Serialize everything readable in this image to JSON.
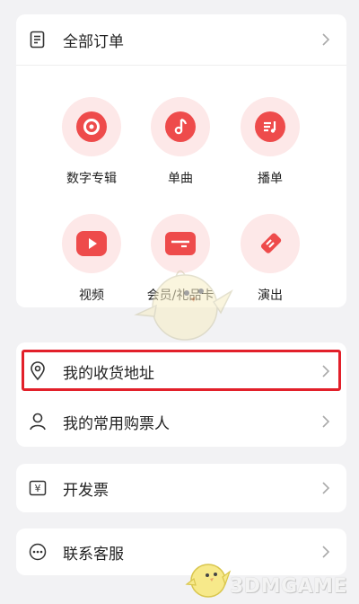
{
  "orders": {
    "all_orders_label": "全部订单",
    "icon": "order-list-icon",
    "grid": [
      {
        "label": "数字专辑",
        "icon": "disc-icon"
      },
      {
        "label": "单曲",
        "icon": "music-note-icon"
      },
      {
        "label": "播单",
        "icon": "playlist-icon"
      },
      {
        "label": "视频",
        "icon": "play-video-icon"
      },
      {
        "label": "会员/礼品卡",
        "icon": "card-icon"
      },
      {
        "label": "演出",
        "icon": "ticket-icon"
      }
    ]
  },
  "address_section": {
    "items": [
      {
        "label": "我的收货地址",
        "icon": "location-pin-icon"
      },
      {
        "label": "我的常用购票人",
        "icon": "person-icon"
      }
    ]
  },
  "invoice": {
    "label": "开发票",
    "icon": "invoice-yen-icon"
  },
  "service": {
    "label": "联系客服",
    "icon": "chat-dots-icon"
  },
  "watermark": {
    "text": "3DMGAME"
  },
  "colors": {
    "accent": "#ee4b4b",
    "highlight_border": "#e2202a",
    "bubble": "#fde8e8",
    "background": "#f2f2f4"
  }
}
